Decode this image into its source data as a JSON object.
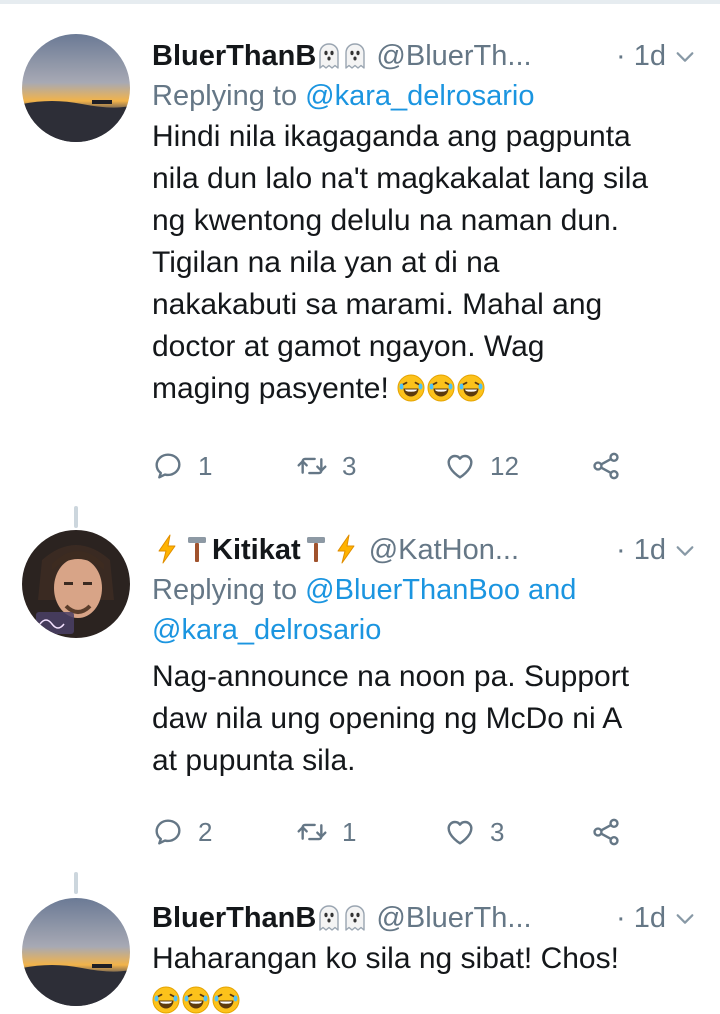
{
  "tweets": [
    {
      "display_name": "BluerThanB",
      "handle": "@BluerTh...",
      "time": "· 1d",
      "reply_label": "Replying to ",
      "reply_to": "@kara_delrosario",
      "text_lines": [
        "Hindi nila ikagaganda ang pagpunta",
        "nila dun lalo na't magkakalat lang sila",
        "ng kwentong delulu na naman dun.",
        "Tigilan na nila yan at di na",
        "nakakabuti sa marami. Mahal ang",
        "doctor at gamot ngayon. Wag",
        "maging pasyente!"
      ],
      "counts": {
        "replies": "1",
        "retweets": "3",
        "likes": "12"
      }
    },
    {
      "display_name": "Kitikat",
      "handle": "@KatHon...",
      "time": "· 1d",
      "reply_label": "Replying to ",
      "reply_to": "@BluerThanBoo and",
      "reply_to_2": "@kara_delrosario",
      "text_lines": [
        "Nag-announce na noon pa. Support",
        "daw nila ung opening ng McDo ni A",
        "at pupunta sila."
      ],
      "counts": {
        "replies": "2",
        "retweets": "1",
        "likes": "3"
      }
    },
    {
      "display_name": "BluerThanB",
      "handle": "@BluerTh...",
      "time": "· 1d",
      "text_lines": [
        "Haharangan ko sila ng sibat! Chos!"
      ]
    }
  ],
  "colors": {
    "text": "#14171a",
    "secondary": "#657786",
    "link": "#1b95e0",
    "divider": "#e6ecf0"
  },
  "icons": [
    "reply-icon",
    "retweet-icon",
    "like-icon",
    "share-icon",
    "caret-down-icon",
    "ghost-emoji",
    "laughing-emoji",
    "lightning-emoji",
    "hammer-emoji"
  ]
}
